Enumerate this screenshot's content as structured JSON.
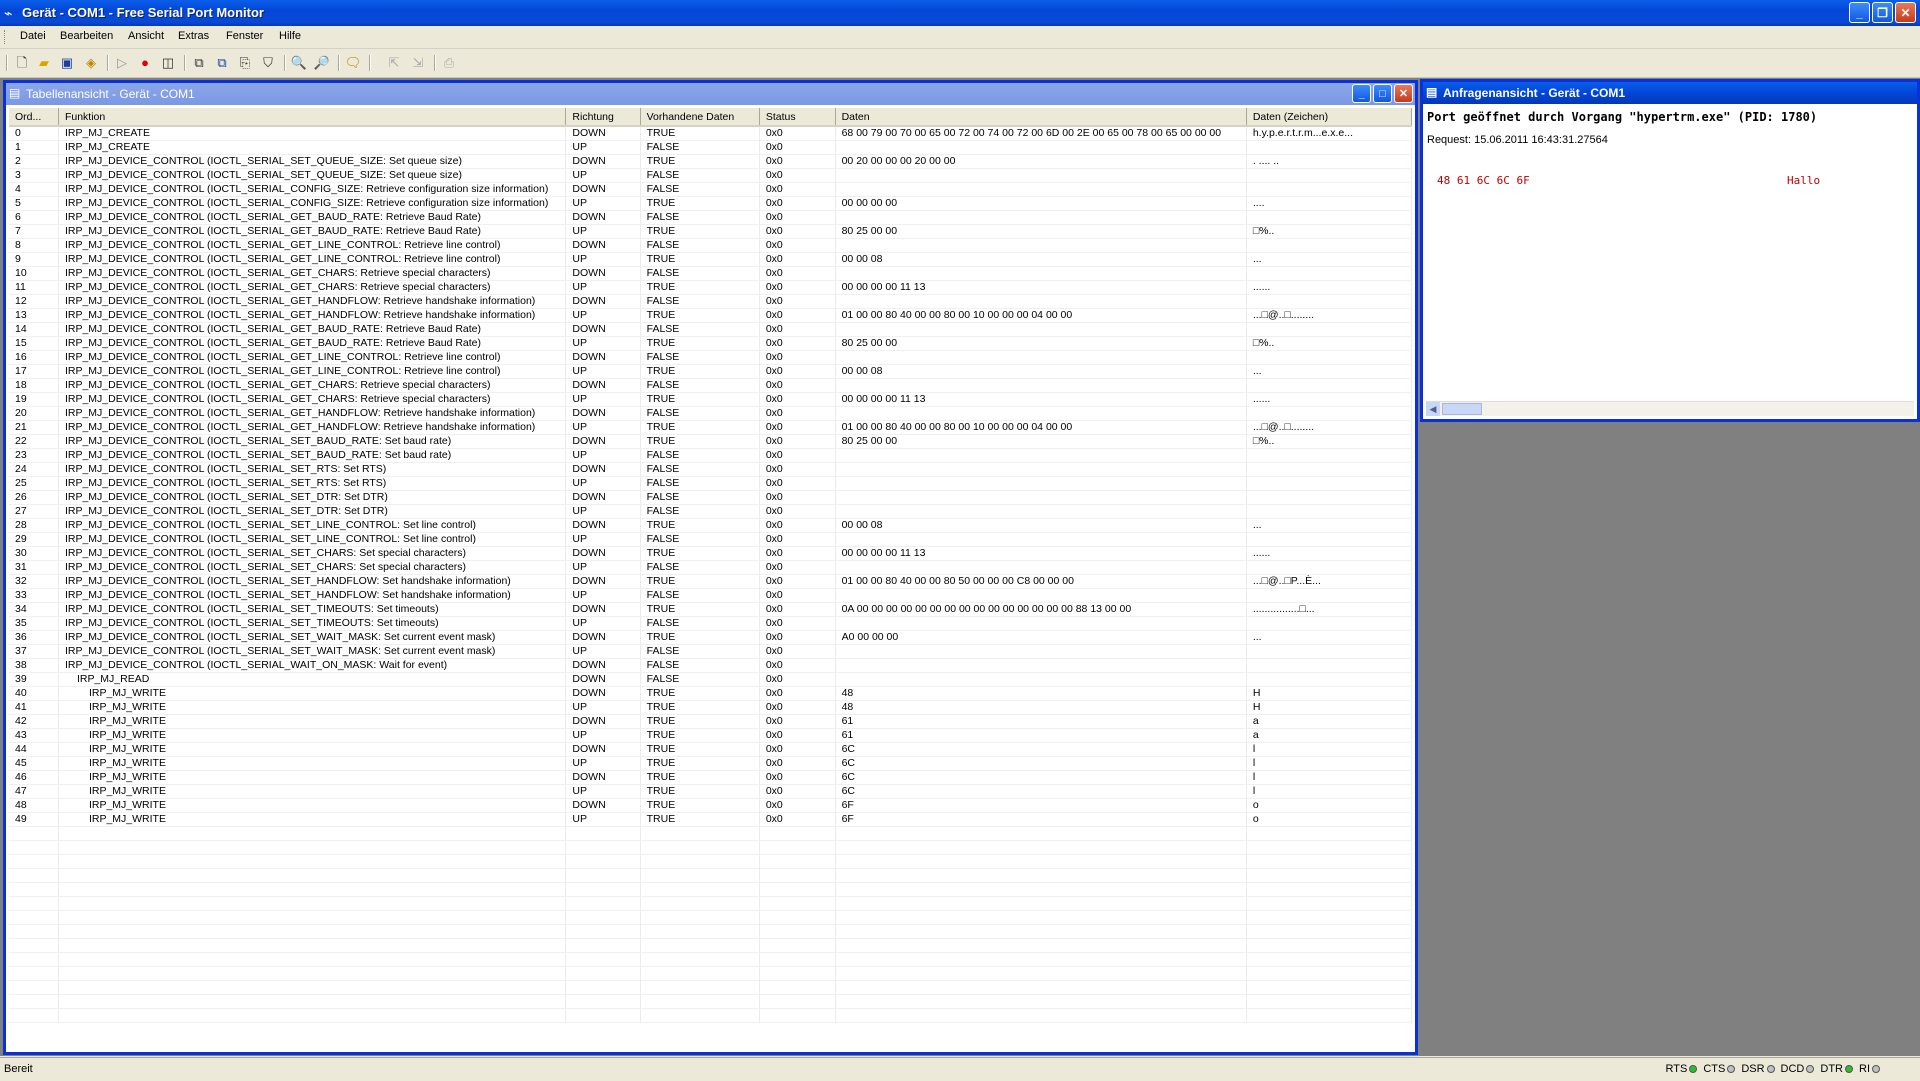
{
  "window": {
    "title": "Gerät - COM1 - Free Serial Port Monitor"
  },
  "menu": [
    "Datei",
    "Bearbeiten",
    "Ansicht",
    "Extras",
    "Fenster",
    "Hilfe"
  ],
  "table_view": {
    "title": "Tabellenansicht - Gerät - COM1",
    "columns": [
      "Ord...",
      "Funktion",
      "Richtung",
      "Vorhandene Daten",
      "Status",
      "Daten",
      "Daten (Zeichen)"
    ],
    "rows": [
      [
        "0",
        "IRP_MJ_CREATE",
        "DOWN",
        "TRUE",
        "0x0",
        "68 00 79 00 70 00 65 00 72 00 74 00 72 00 6D 00 2E 00 65 00 78 00 65 00 00 00",
        "h.y.p.e.r.t.r.m...e.x.e..."
      ],
      [
        "1",
        "IRP_MJ_CREATE",
        "UP",
        "FALSE",
        "0x0",
        "",
        ""
      ],
      [
        "2",
        "IRP_MJ_DEVICE_CONTROL (IOCTL_SERIAL_SET_QUEUE_SIZE: Set queue size)",
        "DOWN",
        "TRUE",
        "0x0",
        "00 20 00 00 00 20 00 00",
        ". .... .."
      ],
      [
        "3",
        "IRP_MJ_DEVICE_CONTROL (IOCTL_SERIAL_SET_QUEUE_SIZE: Set queue size)",
        "UP",
        "FALSE",
        "0x0",
        "",
        ""
      ],
      [
        "4",
        "IRP_MJ_DEVICE_CONTROL (IOCTL_SERIAL_CONFIG_SIZE: Retrieve configuration size information)",
        "DOWN",
        "FALSE",
        "0x0",
        "",
        ""
      ],
      [
        "5",
        "IRP_MJ_DEVICE_CONTROL (IOCTL_SERIAL_CONFIG_SIZE: Retrieve configuration size information)",
        "UP",
        "TRUE",
        "0x0",
        "00 00 00 00",
        "...."
      ],
      [
        "6",
        "IRP_MJ_DEVICE_CONTROL (IOCTL_SERIAL_GET_BAUD_RATE: Retrieve Baud Rate)",
        "DOWN",
        "FALSE",
        "0x0",
        "",
        ""
      ],
      [
        "7",
        "IRP_MJ_DEVICE_CONTROL (IOCTL_SERIAL_GET_BAUD_RATE: Retrieve Baud Rate)",
        "UP",
        "TRUE",
        "0x0",
        "80 25 00 00",
        "□%.."
      ],
      [
        "8",
        "IRP_MJ_DEVICE_CONTROL (IOCTL_SERIAL_GET_LINE_CONTROL: Retrieve line control)",
        "DOWN",
        "FALSE",
        "0x0",
        "",
        ""
      ],
      [
        "9",
        "IRP_MJ_DEVICE_CONTROL (IOCTL_SERIAL_GET_LINE_CONTROL: Retrieve line control)",
        "UP",
        "TRUE",
        "0x0",
        "00 00 08",
        "..."
      ],
      [
        "10",
        "IRP_MJ_DEVICE_CONTROL (IOCTL_SERIAL_GET_CHARS: Retrieve special characters)",
        "DOWN",
        "FALSE",
        "0x0",
        "",
        ""
      ],
      [
        "11",
        "IRP_MJ_DEVICE_CONTROL (IOCTL_SERIAL_GET_CHARS: Retrieve special characters)",
        "UP",
        "TRUE",
        "0x0",
        "00 00 00 00 11 13",
        "......"
      ],
      [
        "12",
        "IRP_MJ_DEVICE_CONTROL (IOCTL_SERIAL_GET_HANDFLOW: Retrieve handshake information)",
        "DOWN",
        "FALSE",
        "0x0",
        "",
        ""
      ],
      [
        "13",
        "IRP_MJ_DEVICE_CONTROL (IOCTL_SERIAL_GET_HANDFLOW: Retrieve handshake information)",
        "UP",
        "TRUE",
        "0x0",
        "01 00 00 80 40 00 00 80 00 10 00 00 00 04 00 00",
        "...□@..□........"
      ],
      [
        "14",
        "IRP_MJ_DEVICE_CONTROL (IOCTL_SERIAL_GET_BAUD_RATE: Retrieve Baud Rate)",
        "DOWN",
        "FALSE",
        "0x0",
        "",
        ""
      ],
      [
        "15",
        "IRP_MJ_DEVICE_CONTROL (IOCTL_SERIAL_GET_BAUD_RATE: Retrieve Baud Rate)",
        "UP",
        "TRUE",
        "0x0",
        "80 25 00 00",
        "□%.."
      ],
      [
        "16",
        "IRP_MJ_DEVICE_CONTROL (IOCTL_SERIAL_GET_LINE_CONTROL: Retrieve line control)",
        "DOWN",
        "FALSE",
        "0x0",
        "",
        ""
      ],
      [
        "17",
        "IRP_MJ_DEVICE_CONTROL (IOCTL_SERIAL_GET_LINE_CONTROL: Retrieve line control)",
        "UP",
        "TRUE",
        "0x0",
        "00 00 08",
        "..."
      ],
      [
        "18",
        "IRP_MJ_DEVICE_CONTROL (IOCTL_SERIAL_GET_CHARS: Retrieve special characters)",
        "DOWN",
        "FALSE",
        "0x0",
        "",
        ""
      ],
      [
        "19",
        "IRP_MJ_DEVICE_CONTROL (IOCTL_SERIAL_GET_CHARS: Retrieve special characters)",
        "UP",
        "TRUE",
        "0x0",
        "00 00 00 00 11 13",
        "......"
      ],
      [
        "20",
        "IRP_MJ_DEVICE_CONTROL (IOCTL_SERIAL_GET_HANDFLOW: Retrieve handshake information)",
        "DOWN",
        "FALSE",
        "0x0",
        "",
        ""
      ],
      [
        "21",
        "IRP_MJ_DEVICE_CONTROL (IOCTL_SERIAL_GET_HANDFLOW: Retrieve handshake information)",
        "UP",
        "TRUE",
        "0x0",
        "01 00 00 80 40 00 00 80 00 10 00 00 00 04 00 00",
        "...□@..□........"
      ],
      [
        "22",
        "IRP_MJ_DEVICE_CONTROL (IOCTL_SERIAL_SET_BAUD_RATE: Set baud rate)",
        "DOWN",
        "TRUE",
        "0x0",
        "80 25 00 00",
        "□%.."
      ],
      [
        "23",
        "IRP_MJ_DEVICE_CONTROL (IOCTL_SERIAL_SET_BAUD_RATE: Set baud rate)",
        "UP",
        "FALSE",
        "0x0",
        "",
        ""
      ],
      [
        "24",
        "IRP_MJ_DEVICE_CONTROL (IOCTL_SERIAL_SET_RTS: Set RTS)",
        "DOWN",
        "FALSE",
        "0x0",
        "",
        ""
      ],
      [
        "25",
        "IRP_MJ_DEVICE_CONTROL (IOCTL_SERIAL_SET_RTS: Set RTS)",
        "UP",
        "FALSE",
        "0x0",
        "",
        ""
      ],
      [
        "26",
        "IRP_MJ_DEVICE_CONTROL (IOCTL_SERIAL_SET_DTR: Set DTR)",
        "DOWN",
        "FALSE",
        "0x0",
        "",
        ""
      ],
      [
        "27",
        "IRP_MJ_DEVICE_CONTROL (IOCTL_SERIAL_SET_DTR: Set DTR)",
        "UP",
        "FALSE",
        "0x0",
        "",
        ""
      ],
      [
        "28",
        "IRP_MJ_DEVICE_CONTROL (IOCTL_SERIAL_SET_LINE_CONTROL: Set line control)",
        "DOWN",
        "TRUE",
        "0x0",
        "00 00 08",
        "..."
      ],
      [
        "29",
        "IRP_MJ_DEVICE_CONTROL (IOCTL_SERIAL_SET_LINE_CONTROL: Set line control)",
        "UP",
        "FALSE",
        "0x0",
        "",
        ""
      ],
      [
        "30",
        "IRP_MJ_DEVICE_CONTROL (IOCTL_SERIAL_SET_CHARS: Set special characters)",
        "DOWN",
        "TRUE",
        "0x0",
        "00 00 00 00 11 13",
        "......"
      ],
      [
        "31",
        "IRP_MJ_DEVICE_CONTROL (IOCTL_SERIAL_SET_CHARS: Set special characters)",
        "UP",
        "FALSE",
        "0x0",
        "",
        ""
      ],
      [
        "32",
        "IRP_MJ_DEVICE_CONTROL (IOCTL_SERIAL_SET_HANDFLOW: Set handshake information)",
        "DOWN",
        "TRUE",
        "0x0",
        "01 00 00 80 40 00 00 80 50 00 00 00 C8 00 00 00",
        "...□@..□P...È..."
      ],
      [
        "33",
        "IRP_MJ_DEVICE_CONTROL (IOCTL_SERIAL_SET_HANDFLOW: Set handshake information)",
        "UP",
        "FALSE",
        "0x0",
        "",
        ""
      ],
      [
        "34",
        "IRP_MJ_DEVICE_CONTROL (IOCTL_SERIAL_SET_TIMEOUTS: Set timeouts)",
        "DOWN",
        "TRUE",
        "0x0",
        "0A 00 00 00 00 00 00 00 00 00 00 00 00 00 00 00 88 13 00 00",
        "................□..."
      ],
      [
        "35",
        "IRP_MJ_DEVICE_CONTROL (IOCTL_SERIAL_SET_TIMEOUTS: Set timeouts)",
        "UP",
        "FALSE",
        "0x0",
        "",
        ""
      ],
      [
        "36",
        "IRP_MJ_DEVICE_CONTROL (IOCTL_SERIAL_SET_WAIT_MASK: Set current event mask)",
        "DOWN",
        "TRUE",
        "0x0",
        "A0 00 00 00",
        " ..."
      ],
      [
        "37",
        "IRP_MJ_DEVICE_CONTROL (IOCTL_SERIAL_SET_WAIT_MASK: Set current event mask)",
        "UP",
        "FALSE",
        "0x0",
        "",
        ""
      ],
      [
        "38",
        "IRP_MJ_DEVICE_CONTROL (IOCTL_SERIAL_WAIT_ON_MASK: Wait for event)",
        "DOWN",
        "FALSE",
        "0x0",
        "",
        ""
      ],
      [
        "39",
        "IRP_MJ_READ",
        "DOWN",
        "FALSE",
        "0x0",
        "",
        ""
      ],
      [
        "40",
        "IRP_MJ_WRITE",
        "DOWN",
        "TRUE",
        "0x0",
        "48",
        "H"
      ],
      [
        "41",
        "IRP_MJ_WRITE",
        "UP",
        "TRUE",
        "0x0",
        "48",
        "H"
      ],
      [
        "42",
        "IRP_MJ_WRITE",
        "DOWN",
        "TRUE",
        "0x0",
        "61",
        "a"
      ],
      [
        "43",
        "IRP_MJ_WRITE",
        "UP",
        "TRUE",
        "0x0",
        "61",
        "a"
      ],
      [
        "44",
        "IRP_MJ_WRITE",
        "DOWN",
        "TRUE",
        "0x0",
        "6C",
        "l"
      ],
      [
        "45",
        "IRP_MJ_WRITE",
        "UP",
        "TRUE",
        "0x0",
        "6C",
        "l"
      ],
      [
        "46",
        "IRP_MJ_WRITE",
        "DOWN",
        "TRUE",
        "0x0",
        "6C",
        "l"
      ],
      [
        "47",
        "IRP_MJ_WRITE",
        "UP",
        "TRUE",
        "0x0",
        "6C",
        "l"
      ],
      [
        "48",
        "IRP_MJ_WRITE",
        "DOWN",
        "TRUE",
        "0x0",
        "6F",
        "o"
      ],
      [
        "49",
        "IRP_MJ_WRITE",
        "UP",
        "TRUE",
        "0x0",
        "6F",
        "o"
      ]
    ],
    "indent_levels": {
      "39": 1,
      "40": 2,
      "41": 2,
      "42": 2,
      "43": 2,
      "44": 2,
      "45": 2,
      "46": 2,
      "47": 2,
      "48": 2,
      "49": 2
    }
  },
  "request_view": {
    "title": "Anfragenansicht - Gerät - COM1",
    "line1": "Port geöffnet durch Vorgang \"hypertrm.exe\" (PID: 1780)",
    "line2": "Request: 15.06.2011 16:43:31.27564",
    "hex": "48 61 6C 6C 6F",
    "ascii": "Hallo"
  },
  "statusbar": {
    "text": "Bereit",
    "leds": [
      {
        "label": "RTS",
        "color": "#2bbf2b"
      },
      {
        "label": "CTS",
        "color": "#c0c0c0"
      },
      {
        "label": "DSR",
        "color": "#c0c0c0"
      },
      {
        "label": "DCD",
        "color": "#c0c0c0"
      },
      {
        "label": "DTR",
        "color": "#2bbf2b"
      },
      {
        "label": "RI",
        "color": "#c0c0c0"
      }
    ]
  },
  "toolbar_icons": [
    "new-icon",
    "open-icon",
    "save-icon",
    "package-icon",
    "play-icon",
    "record-icon",
    "stop-icon",
    "copy-icon",
    "copy-all-icon",
    "paste-icon",
    "filter-icon",
    "find-icon",
    "find-next-icon",
    "comment-icon",
    "export-icon",
    "import-icon",
    "print-icon"
  ]
}
